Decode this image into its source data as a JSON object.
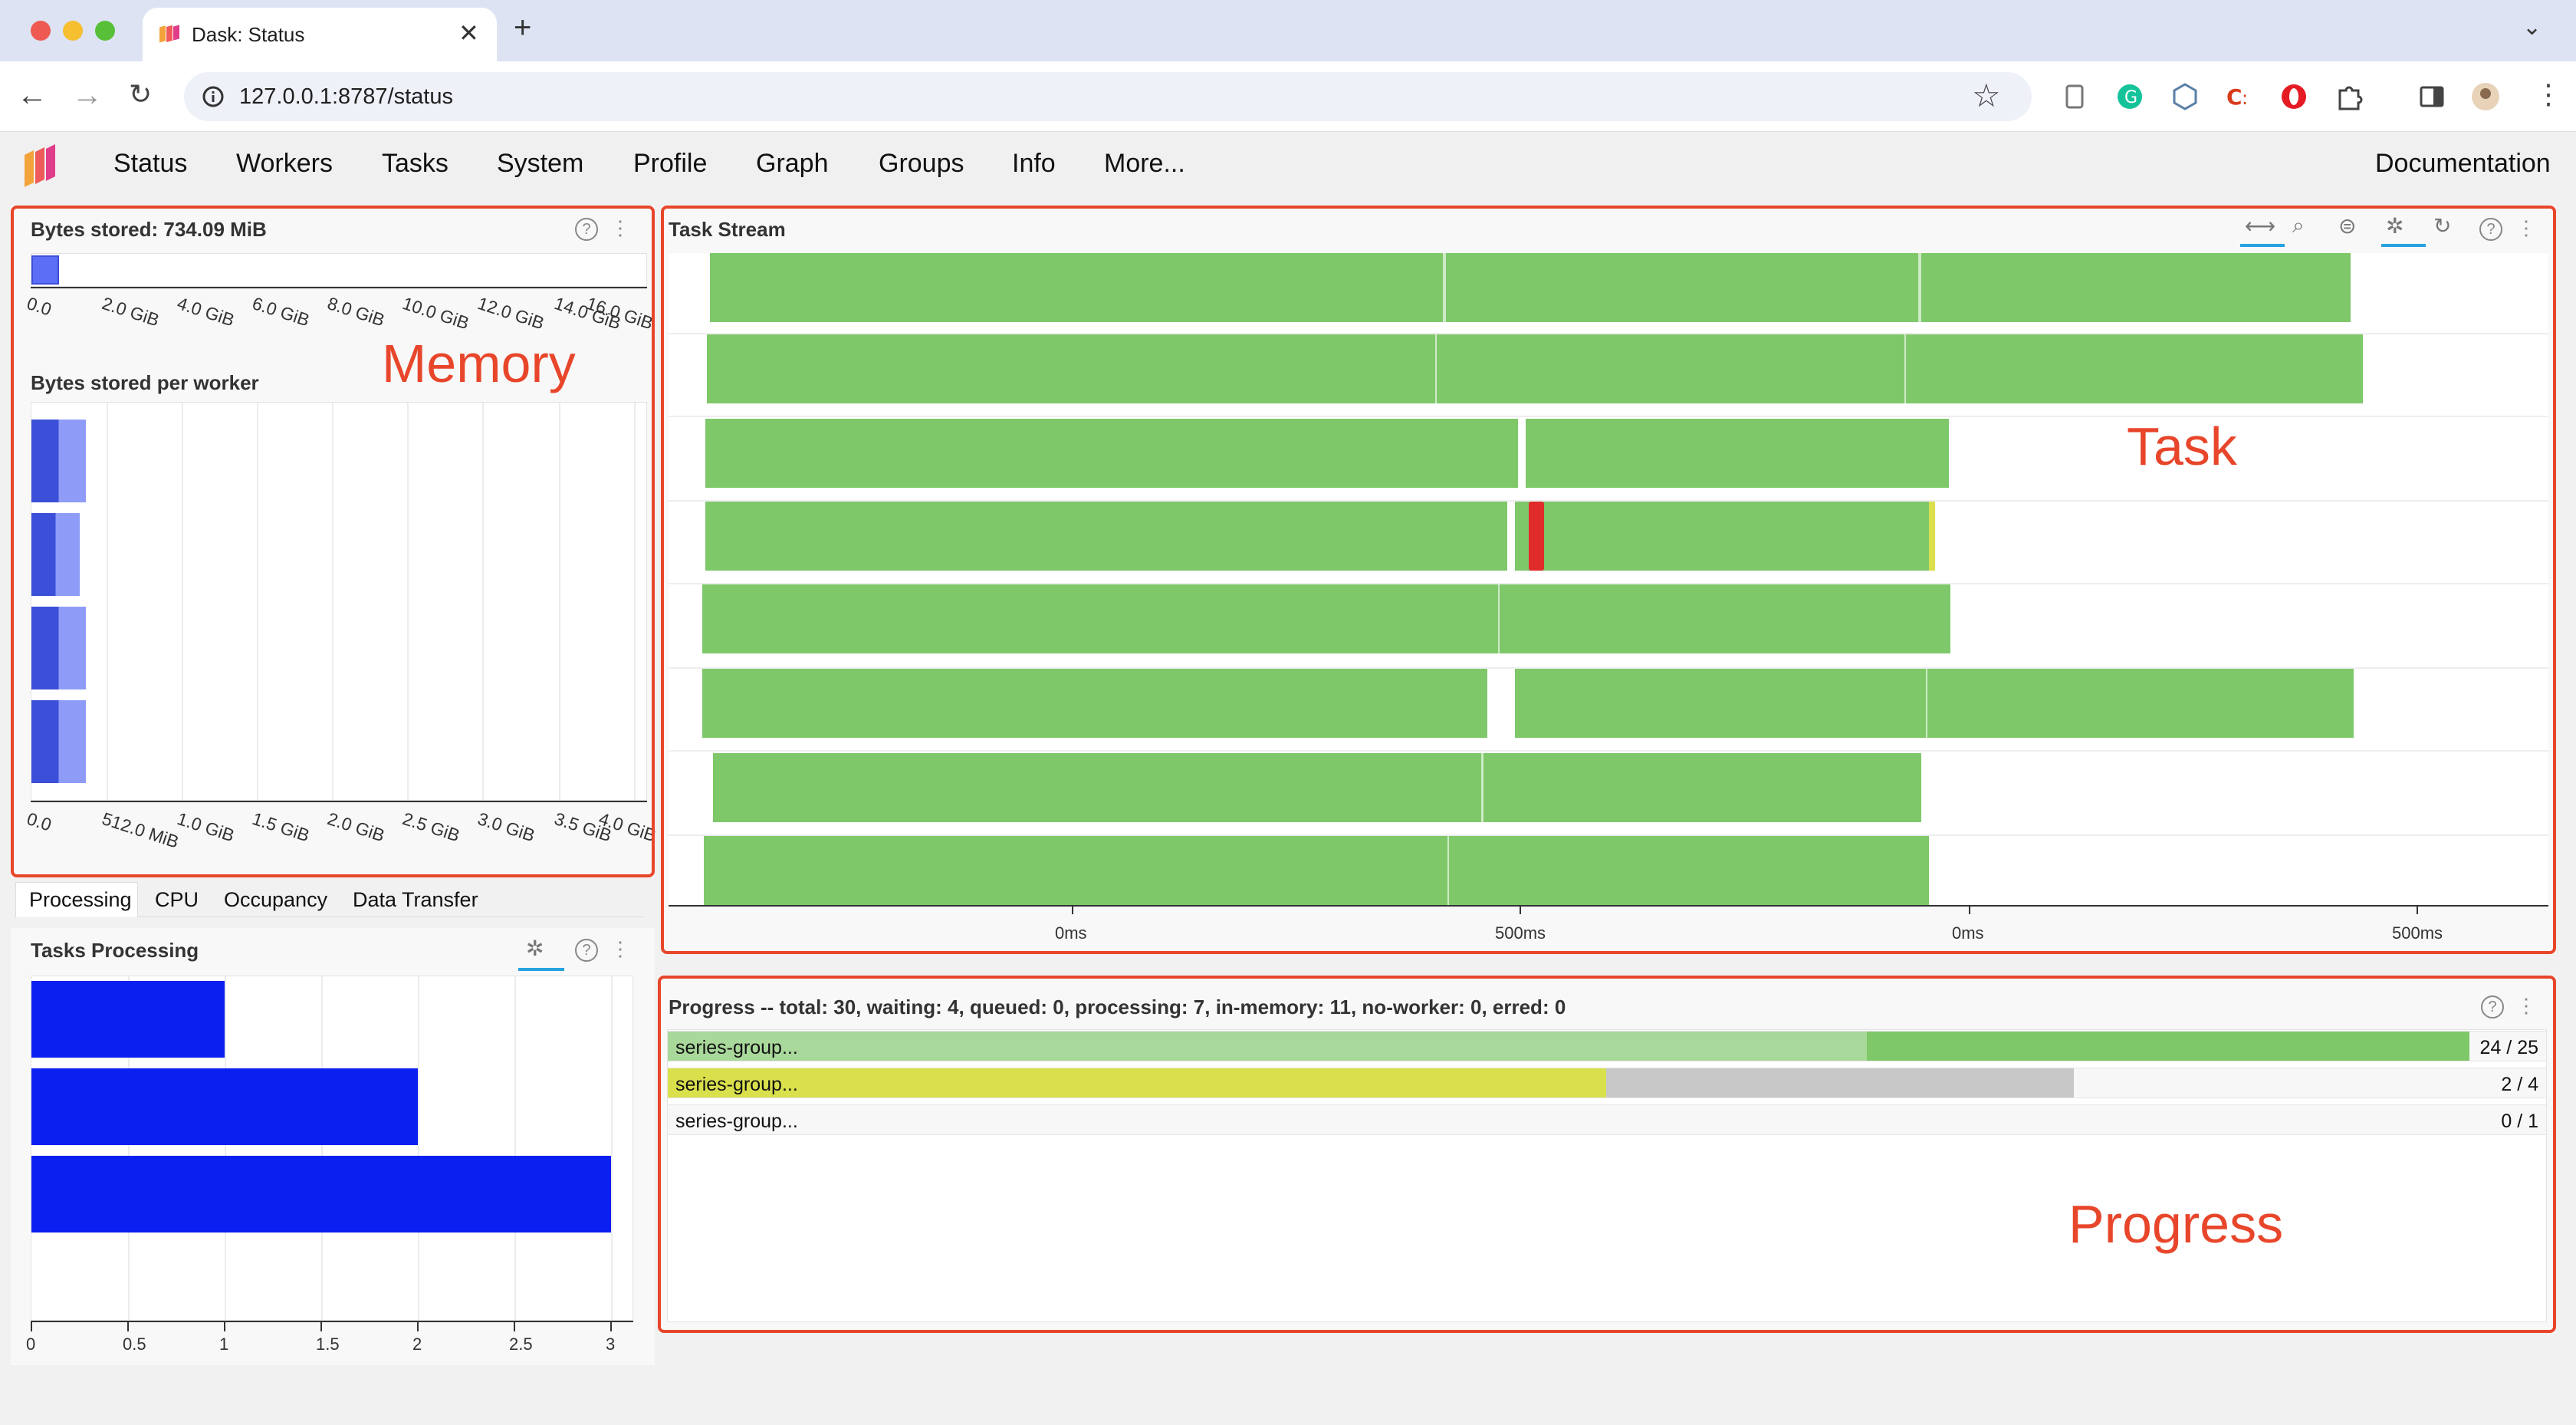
{
  "browser": {
    "tab_title": "Dask: Status",
    "url": "127.0.0.1:8787/status",
    "new_tab": "+",
    "close": "✕",
    "tab_list": "⌄"
  },
  "nav": {
    "items": [
      "Status",
      "Workers",
      "Tasks",
      "System",
      "Profile",
      "Graph",
      "Groups",
      "Info",
      "More..."
    ],
    "documentation": "Documentation"
  },
  "memory": {
    "bytes_stored_title": "Bytes stored: 734.09 MiB",
    "total_axis": [
      "0.0",
      "2.0 GiB",
      "4.0 GiB",
      "6.0 GiB",
      "8.0 GiB",
      "10.0 GiB",
      "12.0 GiB",
      "14.0 GiB",
      "16.0 GiB"
    ],
    "total_bar_fraction": 0.045,
    "per_worker_title": "Bytes stored per worker",
    "per_worker_axis": [
      "0.0",
      "512.0 MiB",
      "1.0 GiB",
      "1.5 GiB",
      "2.0 GiB",
      "2.5 GiB",
      "3.0 GiB",
      "3.5 GiB",
      "4.0 GiB"
    ],
    "per_worker_fraction": [
      0.045,
      0.04,
      0.045,
      0.045
    ],
    "annotation": "Memory"
  },
  "task_stream": {
    "title": "Task Stream",
    "axis_labels": [
      "0ms",
      "500ms",
      "0ms",
      "500ms"
    ],
    "annotation": "Task"
  },
  "left_tabs": [
    "Processing",
    "CPU",
    "Occupancy",
    "Data Transfer"
  ],
  "processing": {
    "title": "Tasks Processing",
    "chart_data": {
      "type": "bar",
      "orientation": "horizontal",
      "values": [
        1,
        2,
        3
      ],
      "xlim": [
        0,
        3
      ],
      "xticks": [
        "0",
        "0.5",
        "1",
        "1.5",
        "2",
        "2.5",
        "3"
      ],
      "color": "#0a1ff0"
    }
  },
  "progress": {
    "title": "Progress -- total: 30, waiting: 4, queued: 0, processing: 7, in-memory: 11, no-worker: 0, erred: 0",
    "rows": [
      {
        "name": "series-group...",
        "count": "24 / 25"
      },
      {
        "name": "series-group...",
        "count": "2 / 4"
      },
      {
        "name": "series-group...",
        "count": "0 / 1"
      }
    ],
    "annotation": "Progress"
  },
  "icons": {
    "help": "?",
    "dots": "⋮"
  },
  "colors": {
    "memory_bar": "#5b6ef5",
    "task_green": "#7ec86a",
    "task_red": "#e02b2b",
    "task_yellow": "#d9e04c",
    "annotation_red": "#e8462b"
  }
}
